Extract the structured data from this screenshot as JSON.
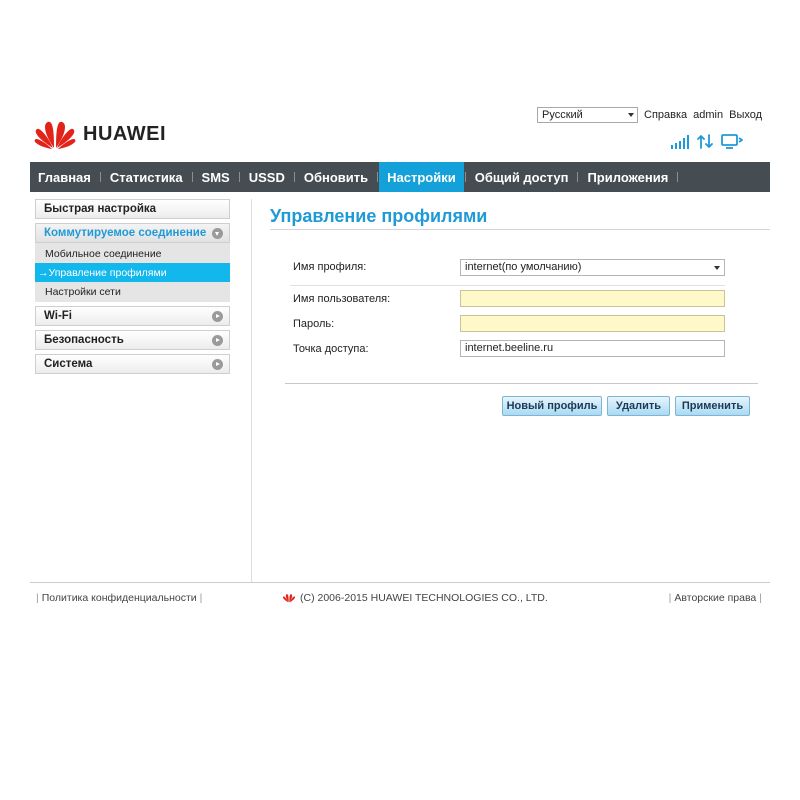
{
  "header": {
    "brand": "HUAWEI",
    "language": "Русский",
    "links": {
      "help": "Справка",
      "user": "admin",
      "logout": "Выход"
    },
    "accent_color": "#1f9ad6",
    "logo_color": "#e2231a"
  },
  "nav": {
    "items": [
      {
        "label": "Главная"
      },
      {
        "label": "Статистика"
      },
      {
        "label": "SMS"
      },
      {
        "label": "USSD"
      },
      {
        "label": "Обновить"
      },
      {
        "label": "Настройки",
        "active": true
      },
      {
        "label": "Общий доступ"
      },
      {
        "label": "Приложения"
      }
    ],
    "bar_color": "#464d52",
    "active_color": "#14a0d8"
  },
  "sidebar": {
    "quick_setup": "Быстрая настройка",
    "dialup": {
      "label": "Коммутируемое соединение",
      "subitems": [
        {
          "label": "Мобильное соединение"
        },
        {
          "label": "→Управление профилями",
          "active": true
        },
        {
          "label": "Настройки сети"
        }
      ]
    },
    "wifi": "Wi-Fi",
    "security": "Безопасность",
    "system": "Система"
  },
  "main": {
    "title": "Управление профилями",
    "form": {
      "profile_label": "Имя профиля:",
      "profile_value": "internet(по умолчанию)",
      "username_label": "Имя пользователя:",
      "username_value": "",
      "password_label": "Пароль:",
      "password_value": "",
      "apn_label": "Точка доступа:",
      "apn_value": "internet.beeline.ru"
    },
    "buttons": {
      "new_profile": "Новый профиль",
      "delete": "Удалить",
      "apply": "Применить"
    }
  },
  "footer": {
    "privacy": "Политика конфиденциальности",
    "copyright": "(C) 2006-2015 HUAWEI TECHNOLOGIES CO., LTD.",
    "rights": "Авторские права"
  }
}
